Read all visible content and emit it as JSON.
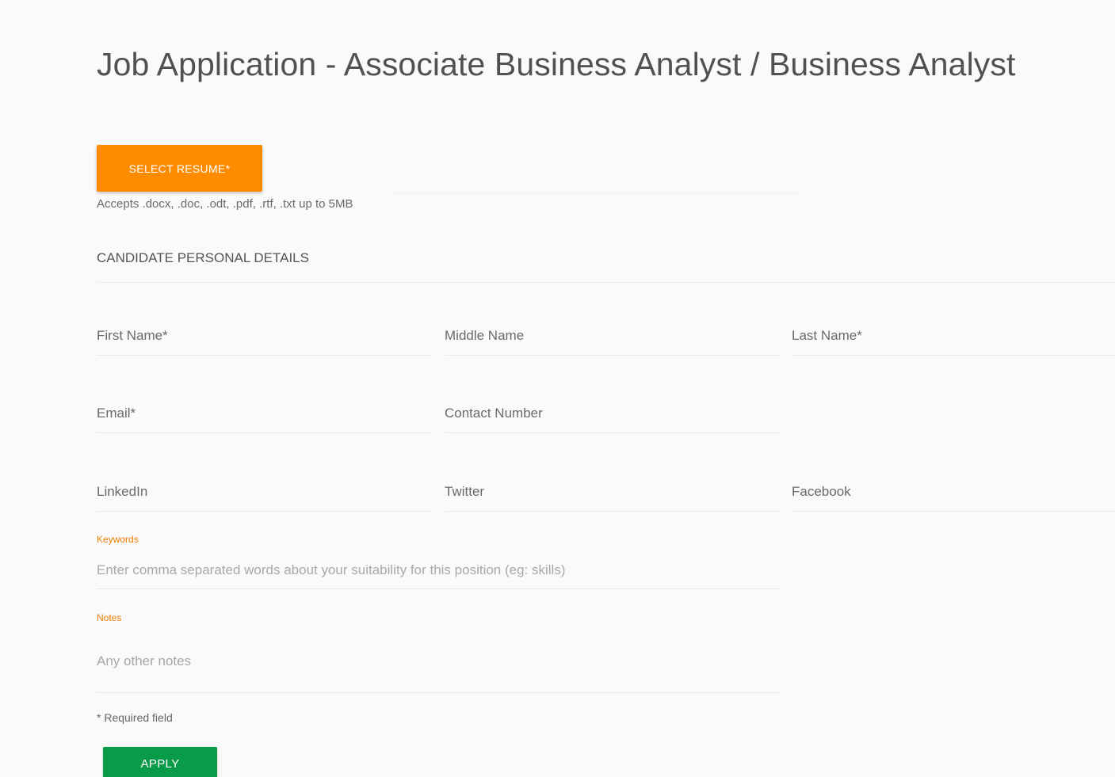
{
  "page": {
    "title": "Job Application - Associate Business Analyst / Business Analyst"
  },
  "resume": {
    "button_label": "SELECT RESUME*",
    "accepts_text": "Accepts .docx, .doc, .odt, .pdf, .rtf, .txt up to 5MB"
  },
  "section": {
    "title": "CANDIDATE PERSONAL DETAILS"
  },
  "fields": {
    "first_name": {
      "placeholder": "First Name*",
      "value": ""
    },
    "middle_name": {
      "placeholder": "Middle Name",
      "value": ""
    },
    "last_name": {
      "placeholder": "Last Name*",
      "value": ""
    },
    "email": {
      "placeholder": "Email*",
      "value": ""
    },
    "contact_number": {
      "placeholder": "Contact Number",
      "value": ""
    },
    "linkedin": {
      "placeholder": "LinkedIn",
      "value": ""
    },
    "twitter": {
      "placeholder": "Twitter",
      "value": ""
    },
    "facebook": {
      "placeholder": "Facebook",
      "value": ""
    },
    "keywords": {
      "label": "Keywords",
      "placeholder": "Enter comma separated words about your suitability for this position (eg: skills)",
      "value": ""
    },
    "notes": {
      "label": "Notes",
      "placeholder": "Any other notes",
      "value": ""
    }
  },
  "footer": {
    "required_note": "* Required field",
    "apply_label": "APPLY"
  },
  "colors": {
    "resume_button": "#ff8c00",
    "apply_button": "#0a9b48",
    "floating_label": "#ef7d00",
    "background": "#fafafa"
  }
}
